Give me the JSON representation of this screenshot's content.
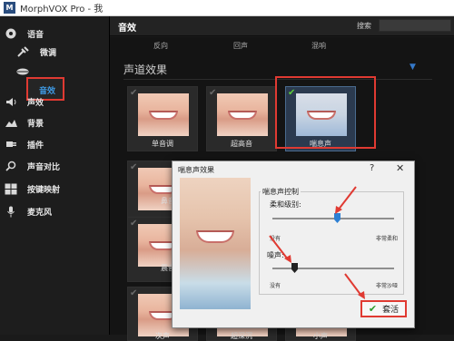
{
  "window": {
    "title": "MorphVOX Pro - 我",
    "logo": "M"
  },
  "sidebar": {
    "items": [
      {
        "label": "语音",
        "icon": "disc-icon"
      },
      {
        "label": "微调",
        "icon": "tools-icon"
      },
      {
        "label": "音效",
        "icon": "lips-icon"
      },
      {
        "label": "声效",
        "icon": "speaker-icon"
      },
      {
        "label": "背景",
        "icon": "landscape-icon"
      },
      {
        "label": "插件",
        "icon": "plug-icon"
      },
      {
        "label": "声音对比",
        "icon": "magnifier-icon"
      },
      {
        "label": "按键映射",
        "icon": "keys-icon"
      },
      {
        "label": "麦克风",
        "icon": "mic-icon"
      }
    ],
    "selected_item": "音效",
    "selected_color": "#3f9be6",
    "highlight_color": "#e03a32"
  },
  "main": {
    "title": "音效",
    "search_label": "搜索",
    "search_value": "",
    "top_row": [
      "反向",
      "回声",
      "混响"
    ],
    "section_title": "声道效果",
    "tiles": [
      {
        "label": "单音调",
        "active": false
      },
      {
        "label": "超高音",
        "active": false
      },
      {
        "label": "喘息声",
        "active": true
      },
      {
        "label": "鼻音",
        "active": false
      },
      {
        "label": "震音",
        "active": false
      },
      {
        "label": "次声",
        "active": false
      },
      {
        "label": "超深沉",
        "active": false
      },
      {
        "label": "小声",
        "active": false
      }
    ]
  },
  "dialog": {
    "title": "喘息声效果",
    "help": "?",
    "close": "✕",
    "group_label": "喘息声控制",
    "softness": {
      "label": "柔和级别:",
      "min_label": "没有",
      "max_label": "非常柔和",
      "value": 0.53
    },
    "noise": {
      "label": "噪声:",
      "min_label": "没有",
      "max_label": "非常沙哑",
      "value": 0.18
    },
    "apply_label": "套活",
    "apply_icon": "checkmark-icon"
  }
}
